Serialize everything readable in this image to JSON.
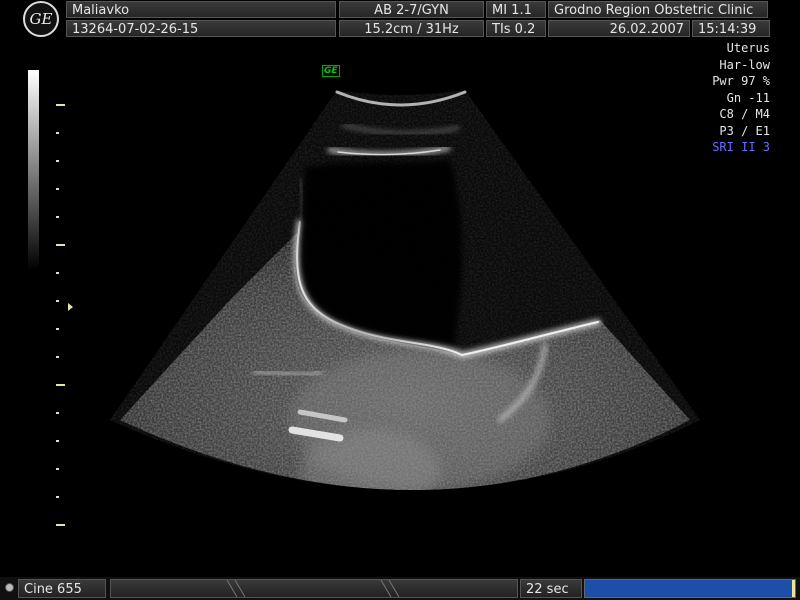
{
  "header": {
    "logo_text": "GE",
    "patient_name": "Maliavko",
    "patient_id": "13264-07-02-26-15",
    "probe_preset": "AB 2-7/GYN",
    "depth_frame": "15.2cm / 31Hz",
    "mi": "MI  1.1",
    "tis": "TIs  0.2",
    "institution": "Grodno Region Obstetric Clinic",
    "date": "26.02.2007",
    "time": "15:14:39"
  },
  "params": [
    "Uterus",
    "Har-low",
    "Pwr  97 %",
    "Gn  -11",
    "C8 / M4",
    "P3 / E1"
  ],
  "sri": "SRI II 3",
  "image_tag": "GE",
  "footer": {
    "cine_label": "Cine 655",
    "timer": "22 sec",
    "cine_progress": 0.99
  },
  "colors": {
    "sri": "#6a6aff",
    "tag": "#00cc00",
    "progress": "#1e4fa8",
    "tick_major": "#e6e6a0"
  }
}
